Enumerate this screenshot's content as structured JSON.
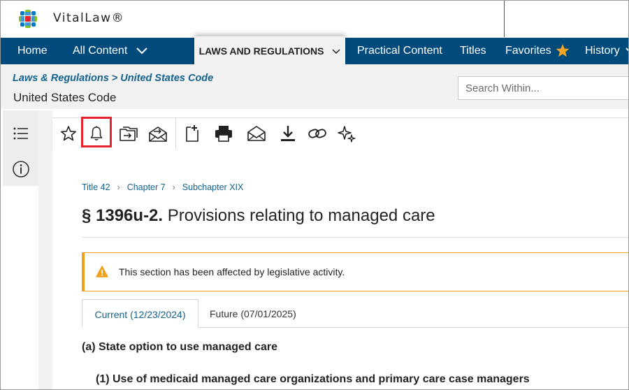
{
  "app": {
    "brand": "VitalLaw®"
  },
  "nav": {
    "home": "Home",
    "all_content": "All Content",
    "laws_regs": "LAWS AND REGULATIONS",
    "practical": "Practical Content",
    "titles": "Titles",
    "favorites": "Favorites",
    "history": "History"
  },
  "breadcrumb": {
    "path": "Laws & Regulations > United States Code",
    "title": "United States Code"
  },
  "search": {
    "placeholder": "Search Within..."
  },
  "toolbar": {
    "icons": [
      "star-icon",
      "bell-icon",
      "shared-folder-icon",
      "email-alert-icon",
      "new-document-icon",
      "print-icon",
      "email-icon",
      "download-icon",
      "link-icon",
      "ai-sparkle-icon"
    ],
    "highlighted": "bell-icon",
    "highlight_color": "#e4242d"
  },
  "document": {
    "crumbs": [
      "Title 42",
      "Chapter 7",
      "Subchapter XIX"
    ],
    "section_number": "§ 1396u-2.",
    "section_title": "Provisions relating to managed care",
    "alert": "This section has been affected by legislative activity.",
    "tabs": {
      "current": "Current (12/23/2024)",
      "future": "Future (07/01/2025)"
    },
    "heading_a": "(a) State option to use managed care",
    "heading_1": "(1) Use of medicaid managed care organizations and primary care case managers"
  },
  "colors": {
    "nav_bg": "#004a7c",
    "link": "#14628e",
    "alert": "#f0a21e",
    "favorite_star": "#f5a623"
  }
}
